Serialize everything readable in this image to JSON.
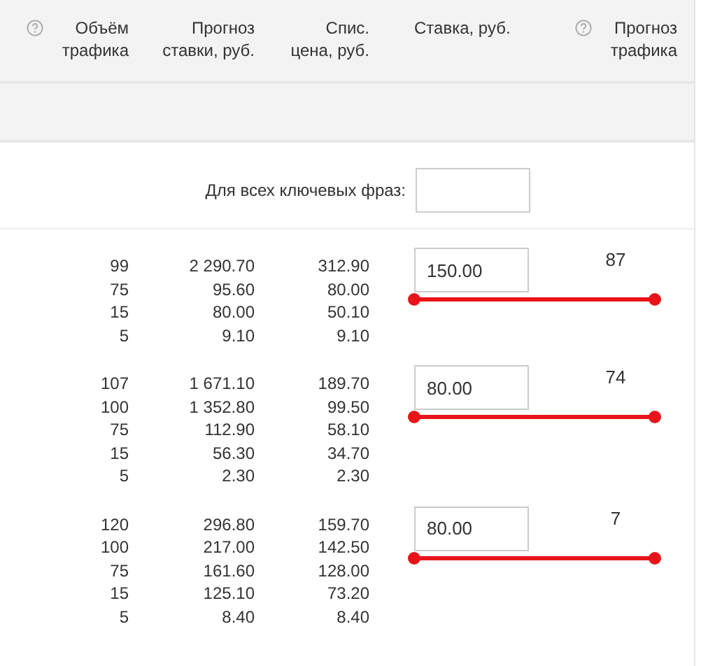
{
  "columns": [
    {
      "label": "Объём трафика",
      "help": true
    },
    {
      "label": "Прогноз ставки, руб.",
      "help": false
    },
    {
      "label": "Спис. цена, руб.",
      "help": false
    },
    {
      "label": "Ставка, руб.",
      "help": false
    },
    {
      "label": "Прогноз трафика",
      "help": true
    }
  ],
  "bulk": {
    "label": "Для всех ключевых фраз:"
  },
  "groups": [
    {
      "traffic": [
        "99",
        "75",
        "15",
        "5"
      ],
      "forecast": [
        "2 290.70",
        "95.60",
        "80.00",
        "9.10"
      ],
      "price": [
        "312.90",
        "80.00",
        "50.10",
        "9.10"
      ],
      "bid": "150.00",
      "traffic_forecast": "87"
    },
    {
      "traffic": [
        "107",
        "100",
        "75",
        "15",
        "5"
      ],
      "forecast": [
        "1 671.10",
        "1 352.80",
        "112.90",
        "56.30",
        "2.30"
      ],
      "price": [
        "189.70",
        "99.50",
        "58.10",
        "34.70",
        "2.30"
      ],
      "bid": "80.00",
      "traffic_forecast": "74"
    },
    {
      "traffic": [
        "120",
        "100",
        "75",
        "15",
        "5"
      ],
      "forecast": [
        "296.80",
        "217.00",
        "161.60",
        "125.10",
        "8.40"
      ],
      "price": [
        "159.70",
        "142.50",
        "128.00",
        "73.20",
        "8.40"
      ],
      "bid": "80.00",
      "traffic_forecast": "7"
    }
  ]
}
